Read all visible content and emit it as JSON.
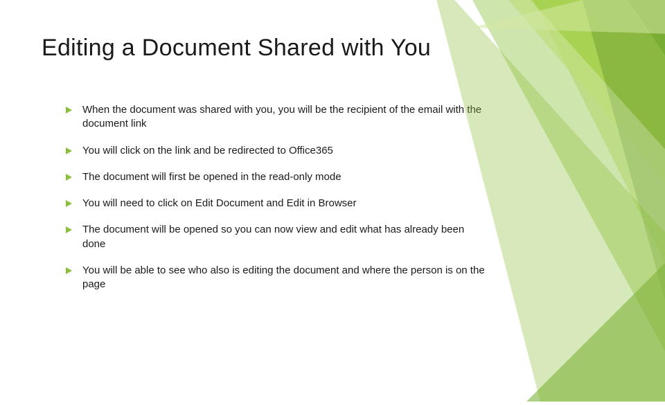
{
  "slide": {
    "title": "Editing a Document Shared with You",
    "bullets": [
      "When the document was shared with you, you will be the recipient of the email with the document link",
      "You will click on the link and be redirected to Office365",
      "The document will first be opened in the read-only mode",
      "You will need to click on Edit Document and Edit in Browser",
      "The document will be opened so you can now view and edit what has already been done",
      "You will be able to see who also is editing the document and where the person is on the page"
    ]
  }
}
